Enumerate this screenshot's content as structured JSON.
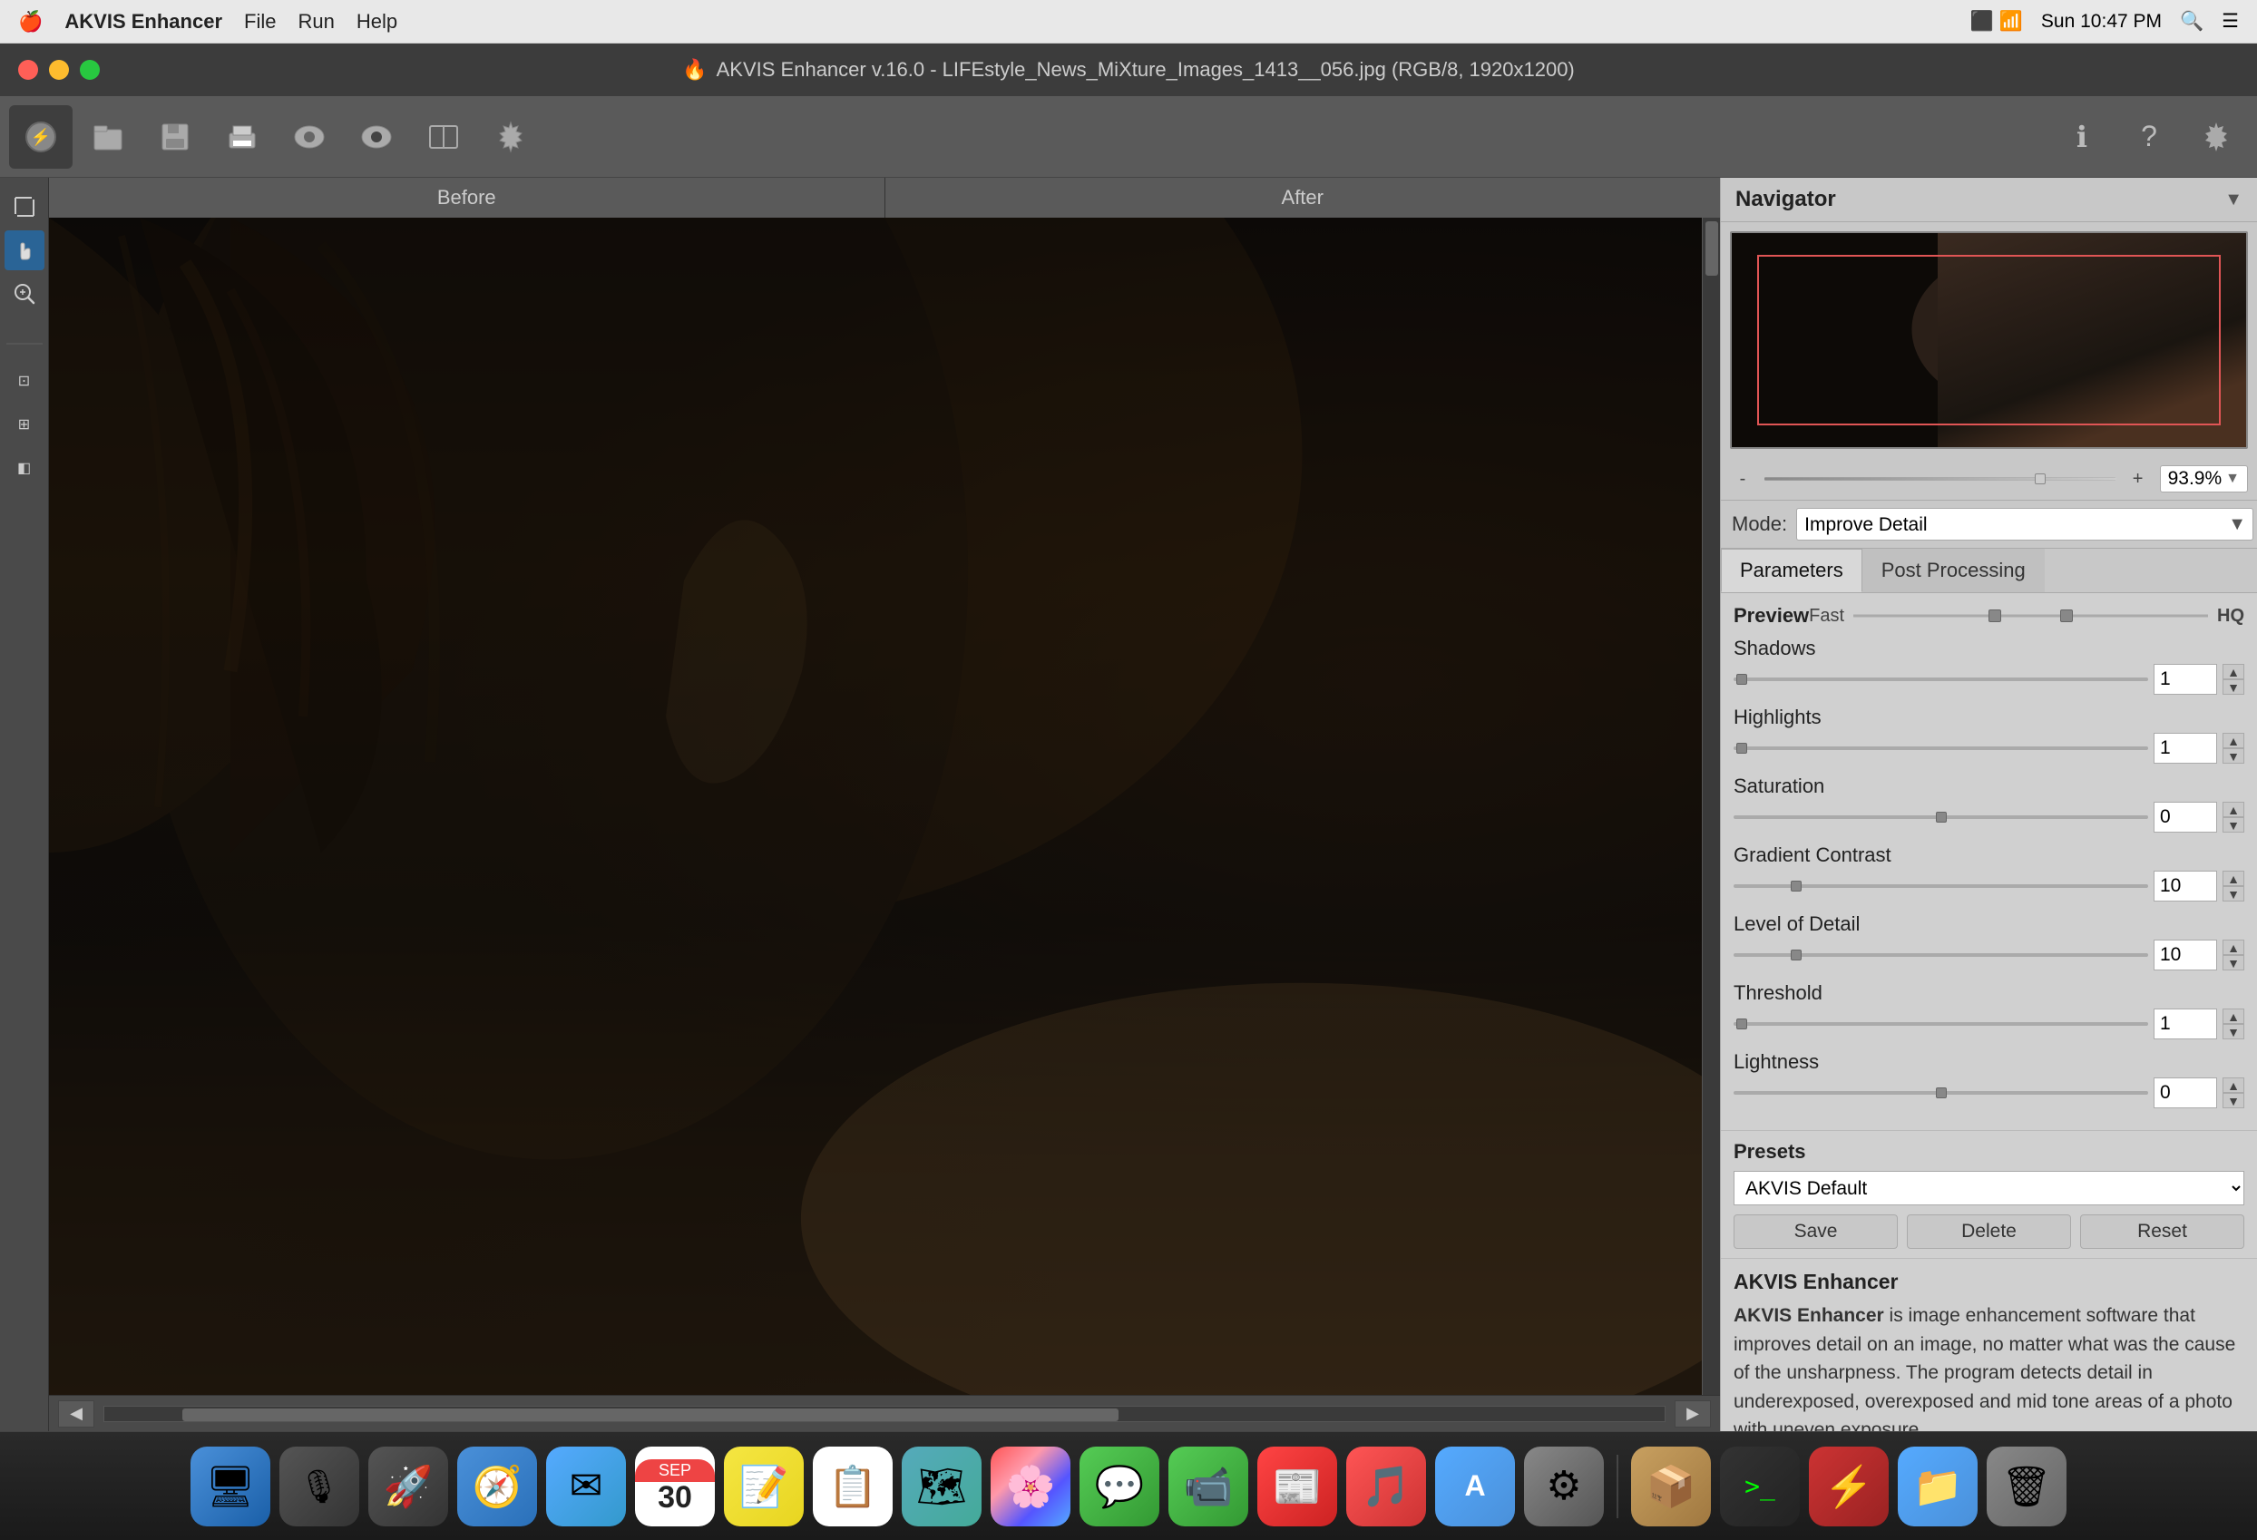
{
  "menubar": {
    "apple": "🍎",
    "appName": "AKVIS Enhancer",
    "items": [
      "File",
      "Run",
      "Help"
    ],
    "time": "Sun 10:47 PM"
  },
  "titlebar": {
    "title": "AKVIS Enhancer v.16.0 - LIFEstyle_News_MiXture_Images_1413__056.jpg (RGB/8, 1920x1200)"
  },
  "toolbar": {
    "tools": [
      {
        "name": "enhance-tool",
        "icon": "⚡",
        "active": true
      },
      {
        "name": "open-tool",
        "icon": "📂"
      },
      {
        "name": "save-tool",
        "icon": "💾"
      },
      {
        "name": "print-tool",
        "icon": "🖨"
      },
      {
        "name": "before-tool",
        "icon": "👁"
      },
      {
        "name": "after-tool",
        "icon": "👁"
      },
      {
        "name": "compare-tool",
        "icon": "⚖"
      },
      {
        "name": "settings-tool",
        "icon": "⚙"
      }
    ],
    "right_tools": [
      {
        "name": "info-btn",
        "icon": "ℹ"
      },
      {
        "name": "help-btn",
        "icon": "?"
      },
      {
        "name": "prefs-btn",
        "icon": "⚙"
      }
    ]
  },
  "left_tools": [
    {
      "name": "crop-tool",
      "icon": "✂",
      "active": false
    },
    {
      "name": "hand-tool",
      "icon": "✋",
      "active": true
    },
    {
      "name": "zoom-tool",
      "icon": "🔍",
      "active": false
    }
  ],
  "canvas": {
    "before_label": "Before",
    "after_label": "After"
  },
  "navigator": {
    "title": "Navigator",
    "zoom_value": "93.9%",
    "zoom_plus": "+",
    "zoom_minus": "-"
  },
  "mode": {
    "label": "Mode:",
    "value": "Improve Detail"
  },
  "tabs": [
    {
      "id": "parameters",
      "label": "Parameters",
      "active": true
    },
    {
      "id": "post-processing",
      "label": "Post Processing",
      "active": false
    }
  ],
  "preview": {
    "label": "Preview",
    "fast_label": "Fast",
    "hq_label": "HQ"
  },
  "parameters": {
    "shadows": {
      "label": "Shadows",
      "value": "1",
      "thumb_pct": 2
    },
    "highlights": {
      "label": "Highlights",
      "value": "1",
      "thumb_pct": 2
    },
    "saturation": {
      "label": "Saturation",
      "value": "0",
      "thumb_pct": 50
    },
    "gradient_contrast": {
      "label": "Gradient Contrast",
      "value": "10",
      "thumb_pct": 15
    },
    "level_of_detail": {
      "label": "Level of Detail",
      "value": "10",
      "thumb_pct": 15
    },
    "threshold": {
      "label": "Threshold",
      "value": "1",
      "thumb_pct": 2
    },
    "lightness": {
      "label": "Lightness",
      "value": "0",
      "thumb_pct": 50
    }
  },
  "presets": {
    "label": "Presets",
    "current": "AKVIS Default",
    "buttons": {
      "save": "Save",
      "delete": "Delete",
      "reset": "Reset"
    }
  },
  "info": {
    "section_title": "AKVIS Enhancer",
    "product_name": "AKVIS Enhancer",
    "description": " is image enhancement software that improves detail on an image, no matter what was the cause of the unsharpness. The program detects detail in underexposed, overexposed and mid tone areas of a photo with uneven exposure"
  },
  "dock": {
    "apps": [
      {
        "name": "finder",
        "label": "Finder",
        "icon": "🖥",
        "class": "dock-icon-finder"
      },
      {
        "name": "siri",
        "label": "Siri",
        "icon": "🎙",
        "class": "dock-icon-siri"
      },
      {
        "name": "launchpad",
        "label": "Launchpad",
        "icon": "🚀",
        "class": "dock-icon-launchpad"
      },
      {
        "name": "safari",
        "label": "Safari",
        "icon": "🧭",
        "class": "dock-icon-safari"
      },
      {
        "name": "mail",
        "label": "Mail",
        "icon": "✉",
        "class": "dock-icon-mail"
      },
      {
        "name": "notes",
        "label": "Notes",
        "icon": "📝",
        "class": "dock-icon-notes"
      },
      {
        "name": "reminders",
        "label": "Reminders",
        "icon": "📋",
        "class": "dock-icon-reminders"
      },
      {
        "name": "maps",
        "label": "Maps",
        "icon": "🗺",
        "class": "dock-icon-maps"
      },
      {
        "name": "photos",
        "label": "Photos",
        "icon": "🌸",
        "class": "dock-icon-photos"
      },
      {
        "name": "messages",
        "label": "Messages",
        "icon": "💬",
        "class": "dock-icon-messages"
      },
      {
        "name": "facetime",
        "label": "Facetime",
        "icon": "📹",
        "class": "dock-icon-facetime"
      },
      {
        "name": "news",
        "label": "News",
        "icon": "📰",
        "class": "dock-icon-news"
      },
      {
        "name": "music",
        "label": "Music",
        "icon": "🎵",
        "class": "dock-icon-music"
      },
      {
        "name": "appstore",
        "label": "App Store",
        "icon": "A",
        "class": "dock-icon-appstore"
      },
      {
        "name": "sysprefs",
        "label": "System Preferences",
        "icon": "⚙",
        "class": "dock-icon-sysprefs"
      },
      {
        "name": "stack",
        "label": "Stack",
        "icon": "📦",
        "class": "dock-icon-stack"
      },
      {
        "name": "terminal",
        "label": "Terminal",
        "icon": ">_",
        "class": "dock-icon-terminal"
      },
      {
        "name": "akvis",
        "label": "AKVIS",
        "icon": "⚡",
        "class": "dock-icon-akvis"
      },
      {
        "name": "folder",
        "label": "Folder",
        "icon": "📁",
        "class": "dock-icon-folder"
      },
      {
        "name": "trash",
        "label": "Trash",
        "icon": "🗑",
        "class": "dock-icon-trash"
      }
    ]
  }
}
